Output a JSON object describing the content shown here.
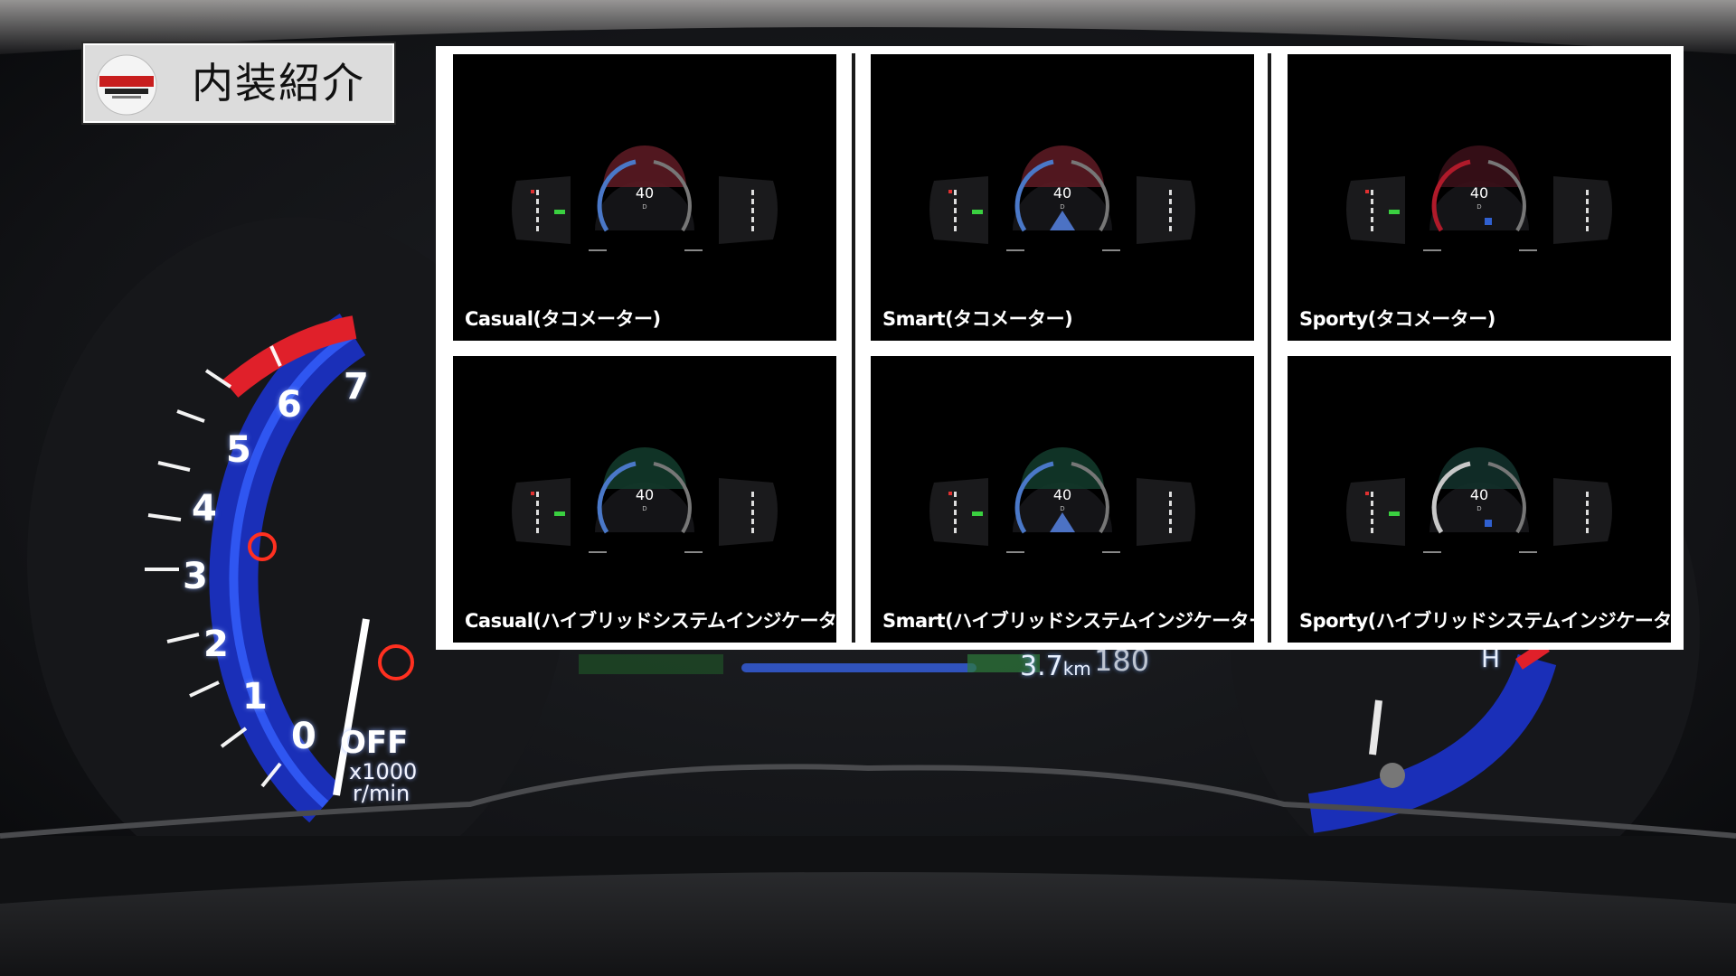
{
  "title_badge": {
    "title": "内装紹介"
  },
  "panel": {
    "cells": [
      {
        "label": "Casual(タコメーター)",
        "speed": "40",
        "gear": "D",
        "accent": "#4a78c8",
        "top_tint": "#5a1a22"
      },
      {
        "label": "Smart(タコメーター)",
        "speed": "40",
        "gear": "D",
        "accent": "#4a78c8",
        "top_tint": "#5a1a22"
      },
      {
        "label": "Sporty(タコメーター)",
        "speed": "40",
        "gear": "D",
        "accent": "#b01a2a",
        "top_tint": "#3a1018"
      },
      {
        "label": "Casual(ハイブリッドシステムインジケーター)",
        "speed": "40",
        "gear": "D",
        "accent": "#4a78c8",
        "top_tint": "#12382a"
      },
      {
        "label": "Smart(ハイブリッドシステムインジケーター)",
        "speed": "40",
        "gear": "D",
        "accent": "#4a78c8",
        "top_tint": "#12382a"
      },
      {
        "label": "Sporty(ハイブリッドシステムインジケーター)",
        "speed": "40",
        "gear": "D",
        "accent": "#c8c8c8",
        "top_tint": "#12302a"
      }
    ]
  },
  "background_cluster": {
    "tach_numbers": [
      "0",
      "1",
      "2",
      "3",
      "4",
      "5",
      "6",
      "7"
    ],
    "off_label": "OFF",
    "unit_label_1": "x1000",
    "unit_label_2": "r/min",
    "distance": "3.7",
    "distance_unit": "km",
    "odo_fragment": "180",
    "temp_high_label": "H",
    "colors": {
      "gauge_blue": "#2240d8",
      "redline": "#e0202a",
      "warning_red": "#ff3020"
    }
  }
}
